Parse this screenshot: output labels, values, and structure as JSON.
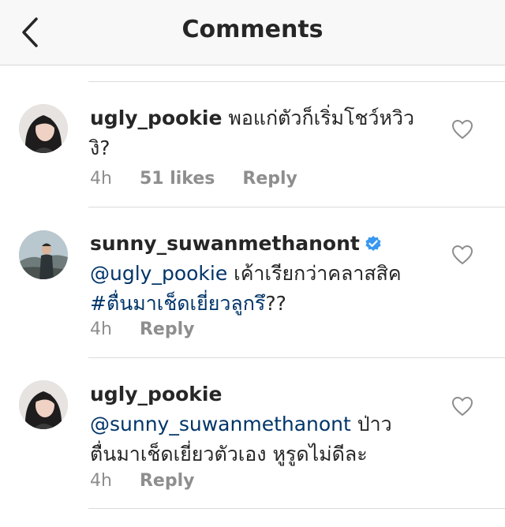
{
  "header": {
    "title": "Comments"
  },
  "comments": [
    {
      "username": "ugly_pookie",
      "text": "พอแก่ตัวก็เริ่มโชว์หวิว",
      "text2": "งิ?",
      "time": "4h",
      "likes": "51 likes",
      "reply_label": "Reply",
      "verified": false
    },
    {
      "username": "sunny_suwanmethanont",
      "mention": "@ugly_pookie",
      "text": " เค้าเรียกว่าคลาสสิค",
      "hashtag": "#ตื่นมาเช็ดเยี่ยวลูกรึ",
      "text2": "??",
      "time": "4h",
      "reply_label": "Reply",
      "verified": true
    },
    {
      "username": "ugly_pookie",
      "mention": "@sunny_suwanmethanont",
      "text": " ป่าว",
      "text2": "ตื่นมาเช็ดเยี่ยวตัวเอง หูรูดไม่ดีละ",
      "time": "4h",
      "reply_label": "Reply",
      "verified": false
    }
  ],
  "colors": {
    "link": "#003569",
    "meta": "#8e8e8e",
    "verified": "#3897f0"
  },
  "icons": {
    "back": "chevron-left-icon",
    "like": "heart-outline-icon",
    "verified": "verified-badge-icon"
  }
}
